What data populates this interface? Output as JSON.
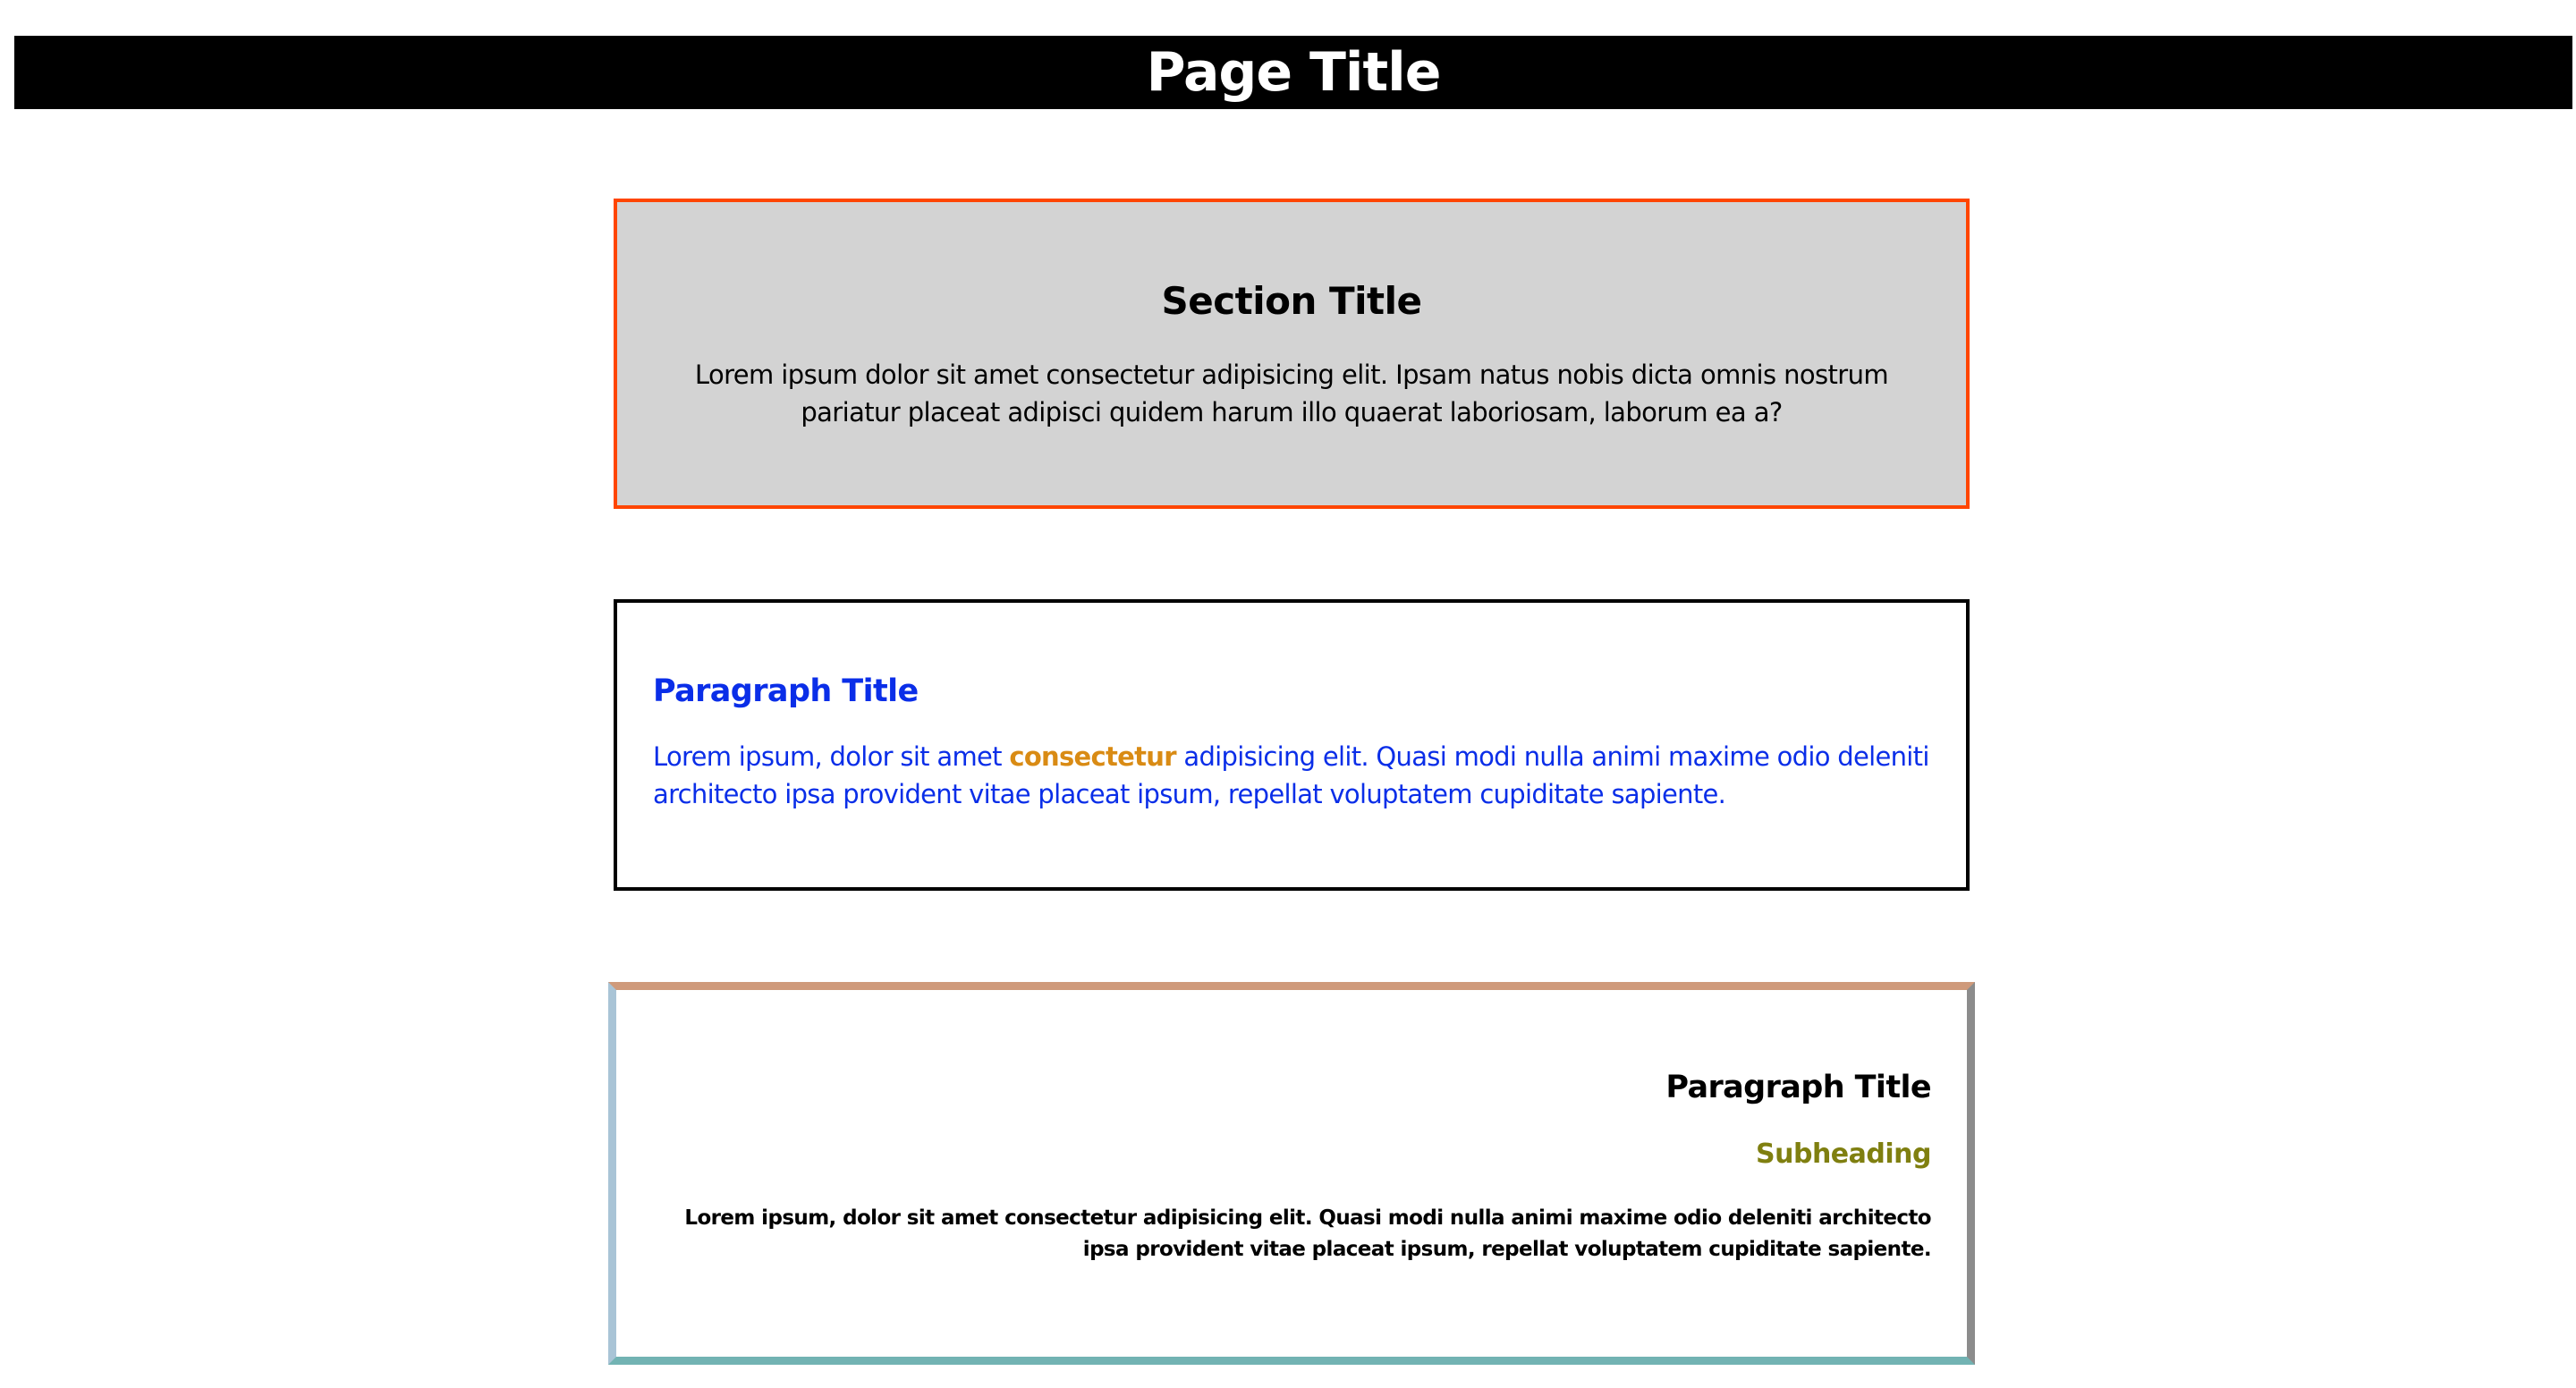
{
  "header": {
    "title": "Page Title"
  },
  "section": {
    "title": "Section Title",
    "text": "Lorem ipsum dolor sit amet consectetur adipisicing elit. Ipsam natus nobis dicta omnis nostrum pariatur placeat adipisci quidem harum illo quaerat laboriosam, laborum ea a?"
  },
  "paragraph_block": {
    "title": "Paragraph Title",
    "text_before": "Lorem ipsum, dolor sit amet ",
    "highlight": "consectetur",
    "text_after": " adipisicing elit. Quasi modi nulla animi maxime odio deleniti architecto ipsa provident vitae placeat ipsum, repellat voluptatem cupiditate sapiente."
  },
  "fancy_block": {
    "title": "Paragraph Title",
    "subheading": "Subheading",
    "text": "Lorem ipsum, dolor sit amet consectetur adipisicing elit. Quasi modi nulla animi maxime odio deleniti architecto ipsa provident vitae placeat ipsum, repellat voluptatem cupiditate sapiente."
  },
  "colors": {
    "header_bg": "#000000",
    "section_bg": "#d3d3d3",
    "section_border": "#ff4500",
    "paragraph_text": "#0a2ee8",
    "highlight": "#d98b14",
    "subheading": "#7f7f10",
    "fancy_border_top": "#cf9a7b",
    "fancy_border_right": "#8c8c8c",
    "fancy_border_bottom": "#72b3b3",
    "fancy_border_left": "#a9c4d6"
  }
}
